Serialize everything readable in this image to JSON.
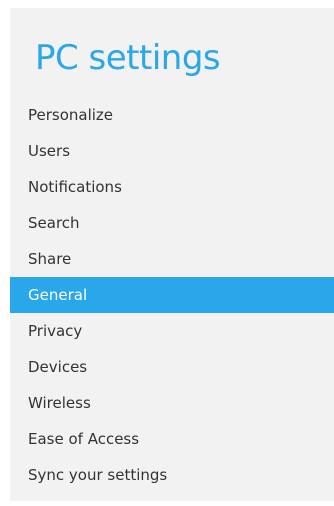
{
  "colors": {
    "accent": "#2aa6ea",
    "panel_bg": "#f2f2f2",
    "text": "#333333",
    "selected_text": "#ffffff"
  },
  "header": {
    "title": "PC settings"
  },
  "menu": {
    "selected": "General",
    "items": [
      {
        "label": "Personalize"
      },
      {
        "label": "Users"
      },
      {
        "label": "Notifications"
      },
      {
        "label": "Search"
      },
      {
        "label": "Share"
      },
      {
        "label": "General"
      },
      {
        "label": "Privacy"
      },
      {
        "label": "Devices"
      },
      {
        "label": "Wireless"
      },
      {
        "label": "Ease of Access"
      },
      {
        "label": "Sync your settings"
      }
    ]
  }
}
